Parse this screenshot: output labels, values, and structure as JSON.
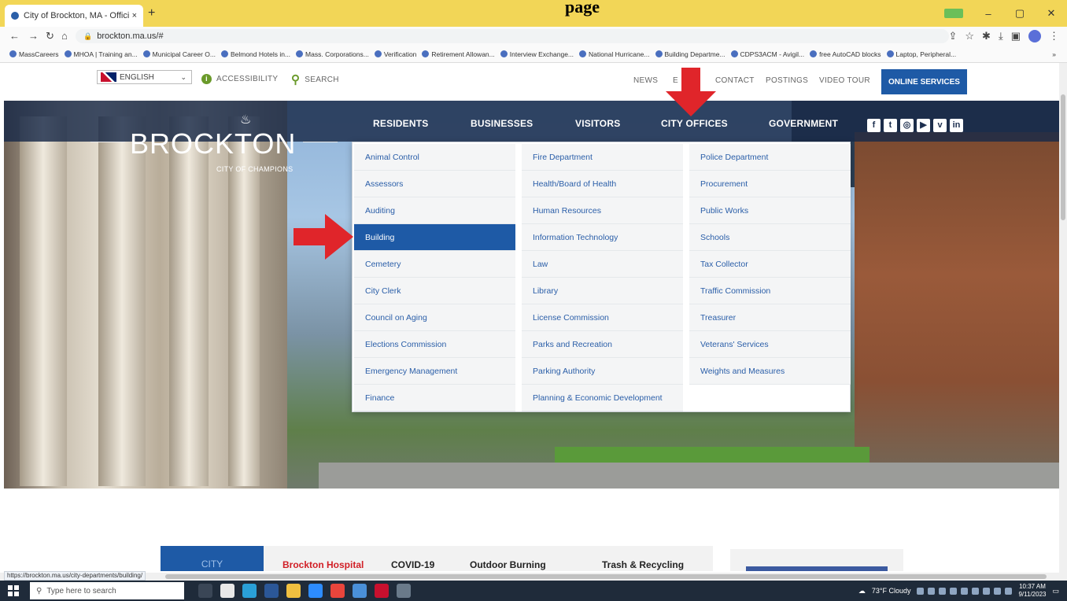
{
  "browser": {
    "tab_title": "City of Brockton, MA - Official W",
    "tab_close": "×",
    "new_tab": "+",
    "url": "brockton.ma.us/#",
    "page_heading": "page",
    "status_url": "https://brockton.ma.us/city-departments/building/",
    "bookmarks": [
      "MassCareers",
      "MHOA | Training an...",
      "Municipal Career O...",
      "Belmond Hotels in...",
      "Mass. Corporations...",
      "Verification",
      "Retirement Allowan...",
      "Interview Exchange...",
      "National Hurricane...",
      "Building Departme...",
      "CDPS3ACM - Avigil...",
      "free AutoCAD blocks",
      "Laptop, Peripheral..."
    ],
    "bookmarks_more": "»"
  },
  "utility": {
    "language": "ENGLISH",
    "accessibility": "ACCESSIBILITY",
    "search": "SEARCH",
    "links": [
      "NEWS",
      "E",
      "CONTACT",
      "POSTINGS",
      "VIDEO TOUR"
    ],
    "online_services": "ONLINE SERVICES"
  },
  "logo": {
    "name": "BROCKTON",
    "tagline": "CITY OF CHAMPIONS"
  },
  "main_nav": [
    "RESIDENTS",
    "BUSINESSES",
    "VISITORS",
    "CITY OFFICES",
    "GOVERNMENT"
  ],
  "social": [
    "f",
    "t",
    "◎",
    "▶",
    "v",
    "in"
  ],
  "dropdown": {
    "col1": [
      "Animal Control",
      "Assessors",
      "Auditing",
      "Building",
      "Cemetery",
      "City Clerk",
      "Council on Aging",
      "Elections Commission",
      "Emergency Management",
      "Finance"
    ],
    "col2": [
      "Fire Department",
      "Health/Board of Health",
      "Human Resources",
      "Information Technology",
      "Law",
      "Library",
      "License Commission",
      "Parks and Recreation",
      "Parking Authority",
      "Planning & Economic Development"
    ],
    "col3": [
      "Police Department",
      "Procurement",
      "Public Works",
      "Schools",
      "Tax Collector",
      "Traffic Commission",
      "Treasurer",
      "Veterans' Services",
      "Weights and Measures"
    ],
    "active": "Building"
  },
  "lower_tabs": {
    "city": "CITY",
    "items": [
      "Brockton Hospital",
      "COVID-19",
      "Outdoor Burning",
      "Trash & Recycling"
    ]
  },
  "taskbar": {
    "search_placeholder": "Type here to search",
    "weather": "73°F Cloudy",
    "time": "10:37 AM",
    "date": "9/11/2023"
  },
  "colors": {
    "accent": "#1e5aa6",
    "arrow": "#e0252a",
    "link": "#2a5ea8",
    "hospital_red": "#d11f26"
  }
}
